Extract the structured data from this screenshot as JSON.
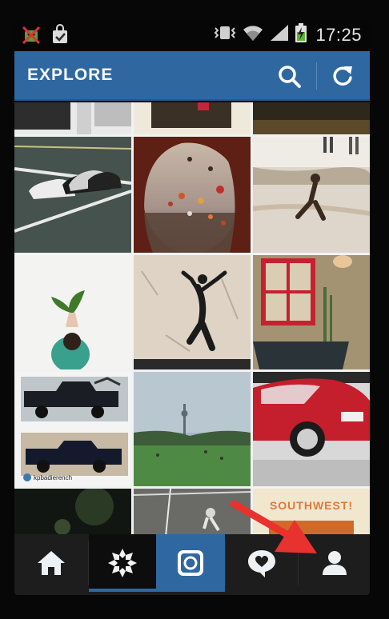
{
  "status_bar": {
    "time": "17:25",
    "icons": [
      "android-debug-icon",
      "shopping-bag-icon",
      "vibrate-icon",
      "wifi-icon",
      "signal-icon",
      "battery-charging-icon"
    ]
  },
  "header": {
    "title": "EXPLORE",
    "actions": [
      "search-icon",
      "refresh-icon"
    ]
  },
  "grid": {
    "tile_text": {
      "username": "kpbadierench",
      "southwest": "SOUTHWEST!"
    }
  },
  "bottom_nav": {
    "items": [
      "home-icon",
      "explore-icon",
      "camera-icon",
      "news-icon",
      "profile-icon"
    ],
    "active": "explore-icon"
  },
  "colors": {
    "header": "#2f68a0",
    "nav_background": "#1d1d1d",
    "annotation_arrow": "#e8322f"
  }
}
